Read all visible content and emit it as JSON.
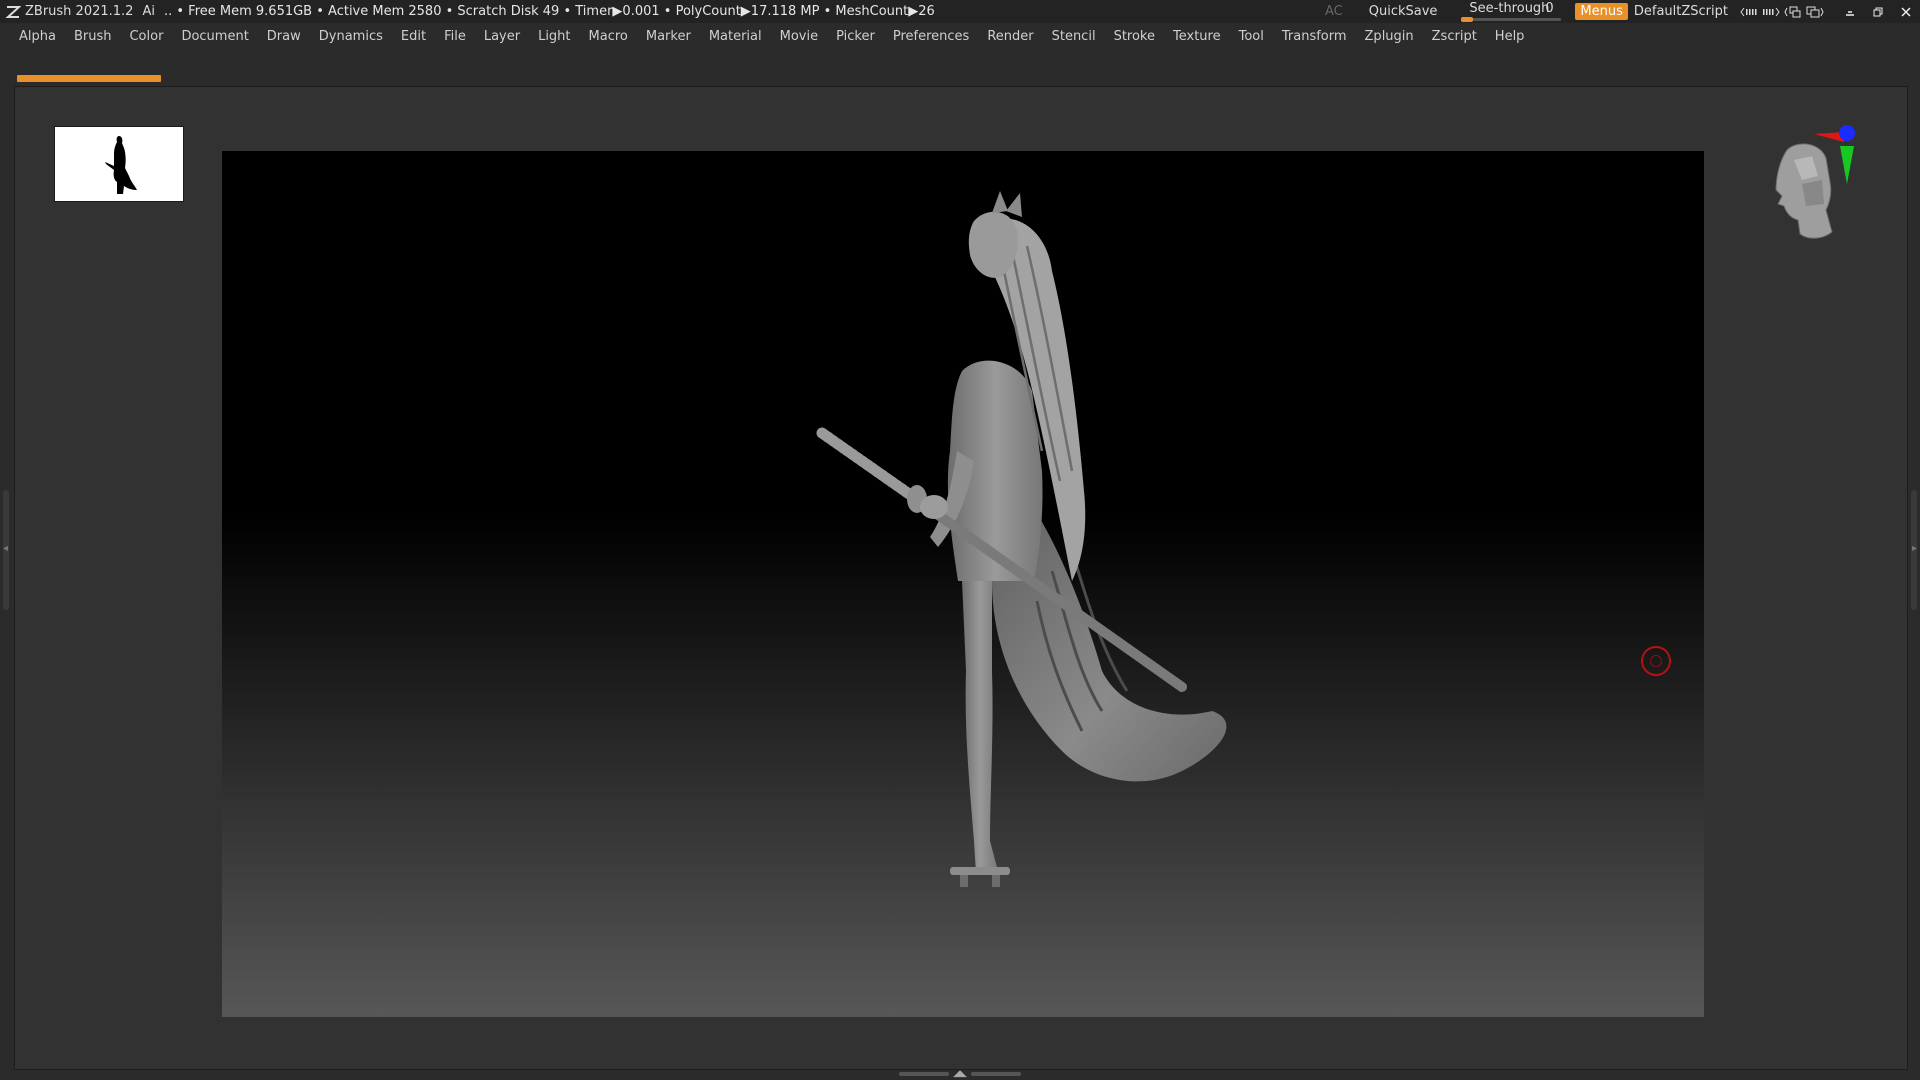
{
  "titlebar": {
    "app_title": "ZBrush 2021.1.2",
    "ai_label": "Ai",
    "stats": ".. • Free Mem 9.651GB • Active Mem 2580 • Scratch Disk 49 •  Timer▶0.001 • PolyCount▶17.118 MP  • MeshCount▶26",
    "ac_label": "AC",
    "quicksave_label": "QuickSave",
    "seethrough_label": "See-through",
    "seethrough_value": "0",
    "seethrough_level": 0.0,
    "menus_label": "Menus",
    "script_label": "DefaultZScript",
    "accent_color": "#e8902a"
  },
  "menubar": {
    "items": [
      "Alpha",
      "Brush",
      "Color",
      "Document",
      "Draw",
      "Dynamics",
      "Edit",
      "File",
      "Layer",
      "Light",
      "Macro",
      "Marker",
      "Material",
      "Movie",
      "Picker",
      "Preferences",
      "Render",
      "Stencil",
      "Stroke",
      "Texture",
      "Tool",
      "Transform",
      "Zplugin",
      "Zscript",
      "Help"
    ]
  },
  "icons": {
    "logo": "zbrush-logo-icon",
    "brush_cursor": "brush-cursor-icon",
    "gizmo": "navigation-head-gizmo-icon"
  }
}
